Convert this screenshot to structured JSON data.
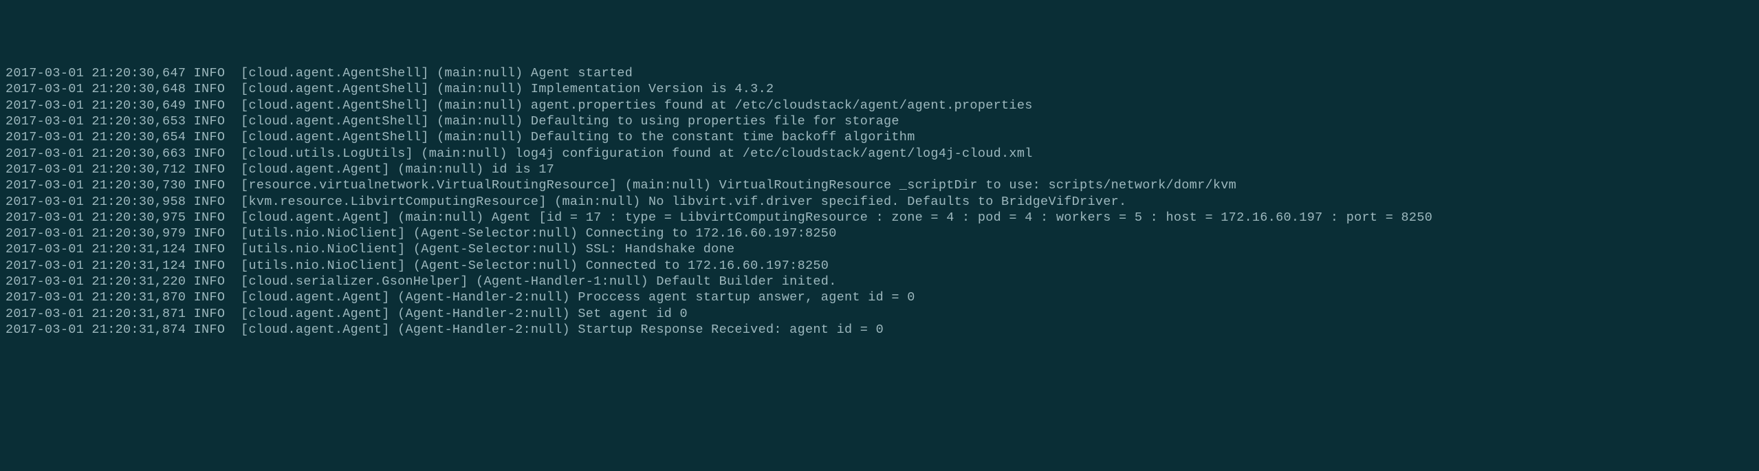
{
  "log_lines": [
    "2017-03-01 21:20:30,647 INFO  [cloud.agent.AgentShell] (main:null) Agent started",
    "2017-03-01 21:20:30,648 INFO  [cloud.agent.AgentShell] (main:null) Implementation Version is 4.3.2",
    "2017-03-01 21:20:30,649 INFO  [cloud.agent.AgentShell] (main:null) agent.properties found at /etc/cloudstack/agent/agent.properties",
    "2017-03-01 21:20:30,653 INFO  [cloud.agent.AgentShell] (main:null) Defaulting to using properties file for storage",
    "2017-03-01 21:20:30,654 INFO  [cloud.agent.AgentShell] (main:null) Defaulting to the constant time backoff algorithm",
    "2017-03-01 21:20:30,663 INFO  [cloud.utils.LogUtils] (main:null) log4j configuration found at /etc/cloudstack/agent/log4j-cloud.xml",
    "2017-03-01 21:20:30,712 INFO  [cloud.agent.Agent] (main:null) id is 17",
    "2017-03-01 21:20:30,730 INFO  [resource.virtualnetwork.VirtualRoutingResource] (main:null) VirtualRoutingResource _scriptDir to use: scripts/network/domr/kvm",
    "2017-03-01 21:20:30,958 INFO  [kvm.resource.LibvirtComputingResource] (main:null) No libvirt.vif.driver specified. Defaults to BridgeVifDriver.",
    "2017-03-01 21:20:30,975 INFO  [cloud.agent.Agent] (main:null) Agent [id = 17 : type = LibvirtComputingResource : zone = 4 : pod = 4 : workers = 5 : host = 172.16.60.197 : port = 8250",
    "2017-03-01 21:20:30,979 INFO  [utils.nio.NioClient] (Agent-Selector:null) Connecting to 172.16.60.197:8250",
    "2017-03-01 21:20:31,124 INFO  [utils.nio.NioClient] (Agent-Selector:null) SSL: Handshake done",
    "2017-03-01 21:20:31,124 INFO  [utils.nio.NioClient] (Agent-Selector:null) Connected to 172.16.60.197:8250",
    "2017-03-01 21:20:31,220 INFO  [cloud.serializer.GsonHelper] (Agent-Handler-1:null) Default Builder inited.",
    "2017-03-01 21:20:31,870 INFO  [cloud.agent.Agent] (Agent-Handler-2:null) Proccess agent startup answer, agent id = 0",
    "2017-03-01 21:20:31,871 INFO  [cloud.agent.Agent] (Agent-Handler-2:null) Set agent id 0",
    "2017-03-01 21:20:31,874 INFO  [cloud.agent.Agent] (Agent-Handler-2:null) Startup Response Received: agent id = 0"
  ]
}
